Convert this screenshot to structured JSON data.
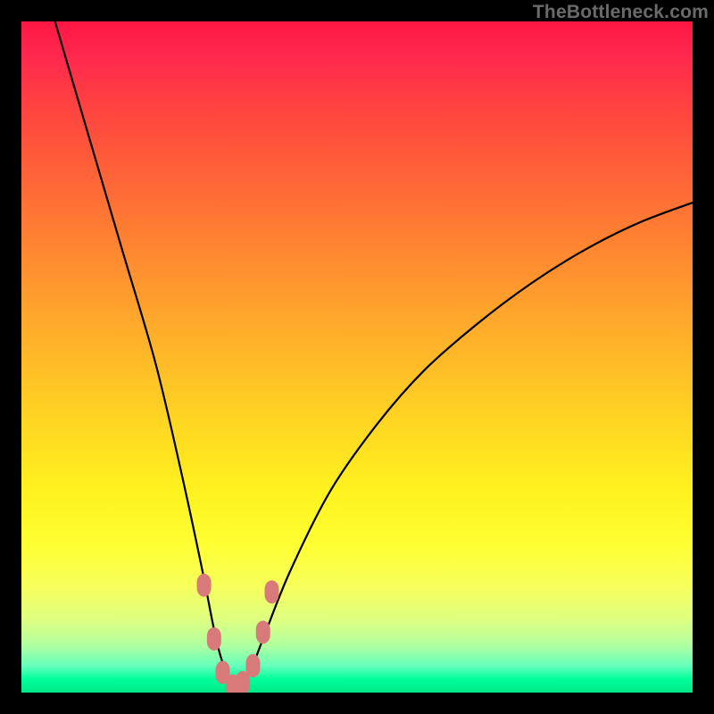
{
  "watermark": "TheBottleneck.com",
  "chart_data": {
    "type": "line",
    "title": "",
    "xlabel": "",
    "ylabel": "",
    "xlim": [
      0,
      100
    ],
    "ylim": [
      0,
      100
    ],
    "background_gradient": [
      "#ff1744",
      "#ffee00",
      "#00e888"
    ],
    "series": [
      {
        "name": "bottleneck-curve",
        "x": [
          5,
          10,
          15,
          20,
          24,
          27,
          29,
          30.5,
          32,
          34,
          36,
          40,
          46,
          53,
          60,
          68,
          76,
          84,
          92,
          100
        ],
        "values": [
          100,
          83,
          66,
          49,
          32,
          18,
          8,
          3,
          0.5,
          3,
          8,
          18,
          30,
          40,
          48,
          55,
          61,
          66,
          70,
          73
        ]
      }
    ],
    "markers": {
      "name": "optimum-zone",
      "color": "#d87a7a",
      "points_x": [
        27.2,
        28.7,
        30.0,
        31.5,
        33.0,
        34.5,
        36.0,
        37.3
      ],
      "points_y": [
        16,
        8,
        3,
        1,
        1.5,
        4,
        9,
        15
      ]
    }
  }
}
